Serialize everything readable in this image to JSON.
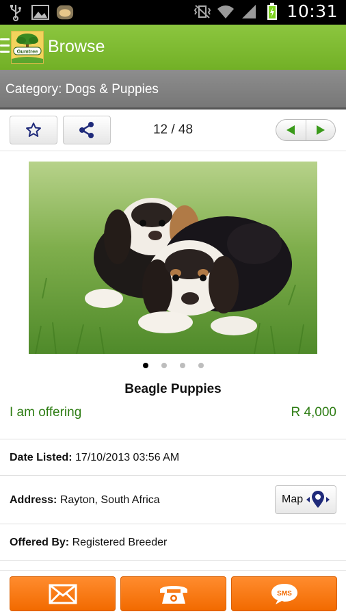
{
  "status_bar": {
    "time": "10:31",
    "icons": [
      "usb-icon",
      "image-icon",
      "notification-thumb-icon",
      "vibrate-icon",
      "wifi-icon",
      "signal-icon",
      "battery-charging-icon"
    ]
  },
  "action_bar": {
    "menu_icon": "hamburger-icon",
    "logo_text": "Gumtree",
    "title": "Browse",
    "color": "#7cbb2f"
  },
  "category_bar": {
    "text": "Category: Dogs & Puppies"
  },
  "toolbar": {
    "favorite_icon": "star-icon",
    "share_icon": "share-icon",
    "pager": "12 / 48",
    "prev_icon": "arrow-left-icon",
    "next_icon": "arrow-right-icon"
  },
  "listing": {
    "image_alt": "puppies-photo",
    "image_count": 4,
    "active_image": 1,
    "title": "Beagle Puppies",
    "offer_type": "I am offering",
    "price": "R 4,000",
    "accent_color": "#2e7d14"
  },
  "details": {
    "date_label": "Date Listed:",
    "date_value": "17/10/2013 03:56 AM",
    "address_label": "Address:",
    "address_value": "Rayton, South Africa",
    "map_label": "Map",
    "offered_label": "Offered By:",
    "offered_value": "Registered Breeder"
  },
  "actions": {
    "email_icon": "email-icon",
    "call_icon": "phone-icon",
    "sms_label": "SMS",
    "button_color": "#f77b12"
  }
}
